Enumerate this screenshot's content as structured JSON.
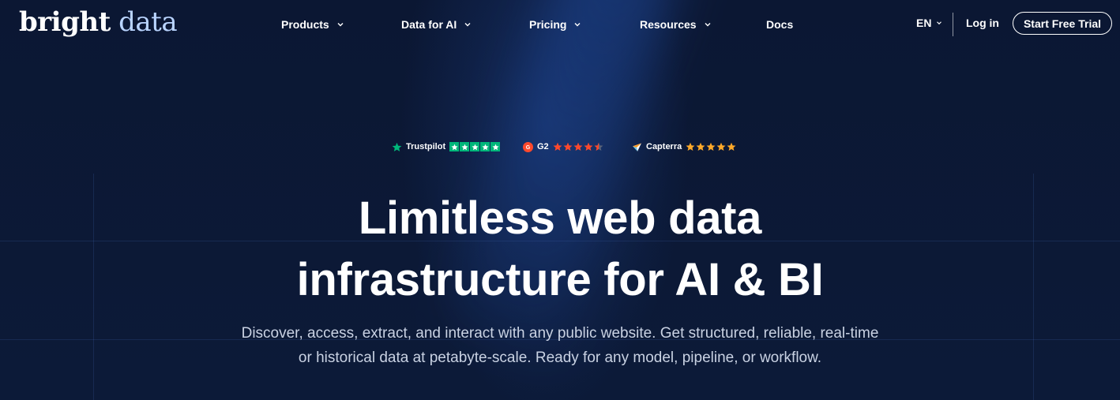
{
  "brand": {
    "word1": "bright",
    "word2": "data"
  },
  "nav": {
    "items": [
      {
        "label": "Products",
        "dropdown": true
      },
      {
        "label": "Data for AI",
        "dropdown": true
      },
      {
        "label": "Pricing",
        "dropdown": true
      },
      {
        "label": "Resources",
        "dropdown": true
      },
      {
        "label": "Docs",
        "dropdown": false
      }
    ],
    "language": "EN",
    "login_label": "Log in",
    "cta_label": "Start Free Trial"
  },
  "ratings": [
    {
      "name": "Trustpilot",
      "icon": "trustpilot-star-icon",
      "stars": 5,
      "star_color": "#00b67a"
    },
    {
      "name": "G2",
      "icon": "g2-logo-icon",
      "stars": 4.5,
      "star_color": "#ff492c"
    },
    {
      "name": "Capterra",
      "icon": "capterra-logo-icon",
      "stars": 5,
      "star_color": "#ffa929"
    }
  ],
  "hero": {
    "headline_line1": "Limitless web data",
    "headline_line2": "infrastructure for AI & BI",
    "sub_line1": "Discover, access, extract, and interact with any public website. Get structured, reliable, real-time",
    "sub_line2": "or historical data at petabyte-scale. Ready for any model, pipeline, or workflow."
  },
  "colors": {
    "background": "#0b1733",
    "text": "#ffffff",
    "subtext": "#c9d2e3",
    "logo_accent": "#b9d4ff"
  }
}
